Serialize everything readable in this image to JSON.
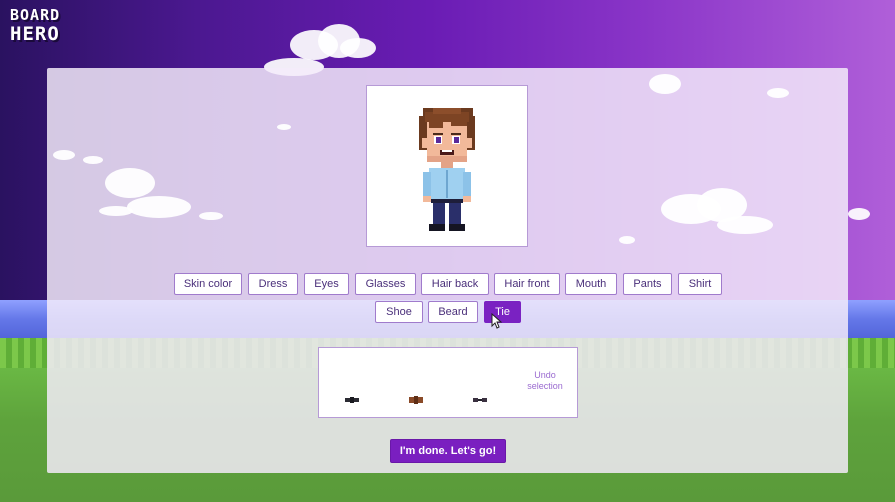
{
  "logo": {
    "line1": "BOARD",
    "line2": "HERO"
  },
  "categories": [
    {
      "label": "Skin color",
      "active": false
    },
    {
      "label": "Dress",
      "active": false
    },
    {
      "label": "Eyes",
      "active": false
    },
    {
      "label": "Glasses",
      "active": false
    },
    {
      "label": "Hair back",
      "active": false
    },
    {
      "label": "Hair front",
      "active": false
    },
    {
      "label": "Mouth",
      "active": false
    },
    {
      "label": "Pants",
      "active": false
    },
    {
      "label": "Shirt",
      "active": false
    },
    {
      "label": "Shoe",
      "active": false
    },
    {
      "label": "Beard",
      "active": false
    },
    {
      "label": "Tie",
      "active": true
    }
  ],
  "options_panel": {
    "undo_label_line1": "Undo",
    "undo_label_line2": "selection",
    "tie_options": [
      {
        "name": "black-tie-option",
        "color": "#2b2b33"
      },
      {
        "name": "brown-tie-option",
        "color": "#8a4a28"
      },
      {
        "name": "dark-tie-option",
        "color": "#3a3040"
      }
    ]
  },
  "done_button": {
    "label": "I'm done. Let's go!"
  },
  "colors": {
    "accent": "#7a22c2",
    "button_border": "#a07bcc",
    "button_text": "#4a2f7a"
  }
}
